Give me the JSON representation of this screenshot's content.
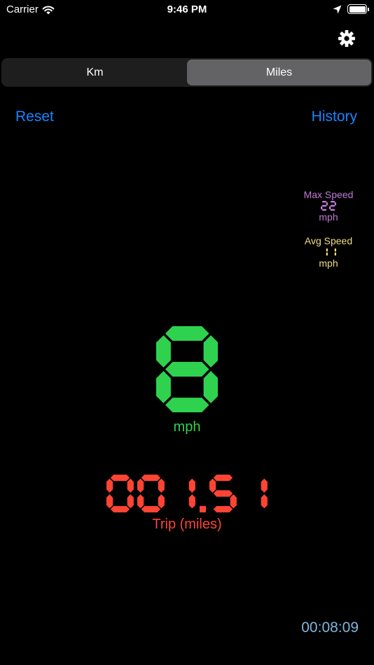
{
  "status_bar": {
    "carrier": "Carrier",
    "time": "9:46 PM",
    "icons": [
      "wifi-icon",
      "location-arrow-icon",
      "battery-icon"
    ]
  },
  "settings": {
    "icon": "gear-icon"
  },
  "units_toggle": {
    "options": [
      "Km",
      "Miles"
    ],
    "selected": "Miles"
  },
  "nav": {
    "reset_label": "Reset",
    "history_label": "History"
  },
  "stats": {
    "max_speed": {
      "label": "Max Speed",
      "value": "22",
      "unit": "mph"
    },
    "avg_speed": {
      "label": "Avg Speed",
      "value": "11",
      "unit": "mph"
    }
  },
  "speed": {
    "value": "8",
    "unit": "mph"
  },
  "trip": {
    "value": "001.51",
    "label": "Trip (miles)"
  },
  "timer": {
    "value": "00:08:09"
  },
  "colors": {
    "accent": "#1a84ff",
    "speed": "#2fd24e",
    "trip": "#ff4433",
    "max_speed": "#c27ad6",
    "avg_speed": "#f3dc84",
    "timer": "#7fb6de"
  }
}
